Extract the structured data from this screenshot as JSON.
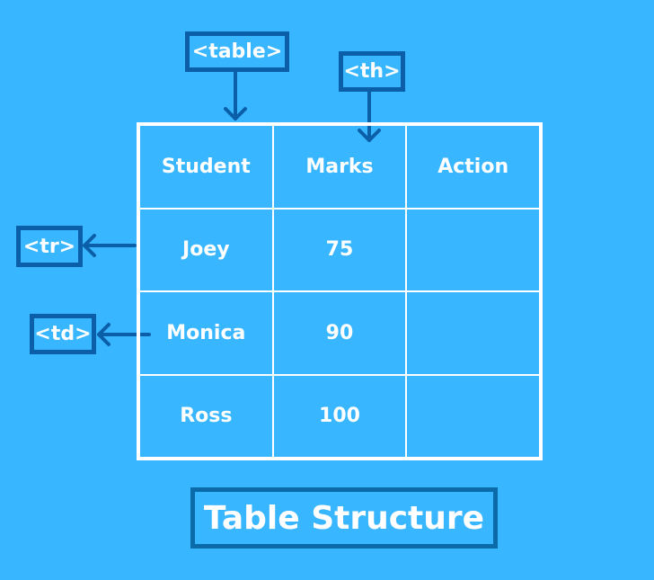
{
  "labels": {
    "table": "<table>",
    "th": "<th>",
    "tr": "<tr>",
    "td": "<td>"
  },
  "table": {
    "headers": [
      "Student",
      "Marks",
      "Action"
    ],
    "rows": [
      [
        "Joey",
        "75",
        ""
      ],
      [
        "Monica",
        "90",
        ""
      ],
      [
        "Ross",
        "100",
        ""
      ]
    ]
  },
  "title": "Table Structure",
  "colors": {
    "background": "#38b6ff",
    "label_border": "#0b5fa8",
    "grid_lines": "#ffffff",
    "text": "#ffffff"
  }
}
